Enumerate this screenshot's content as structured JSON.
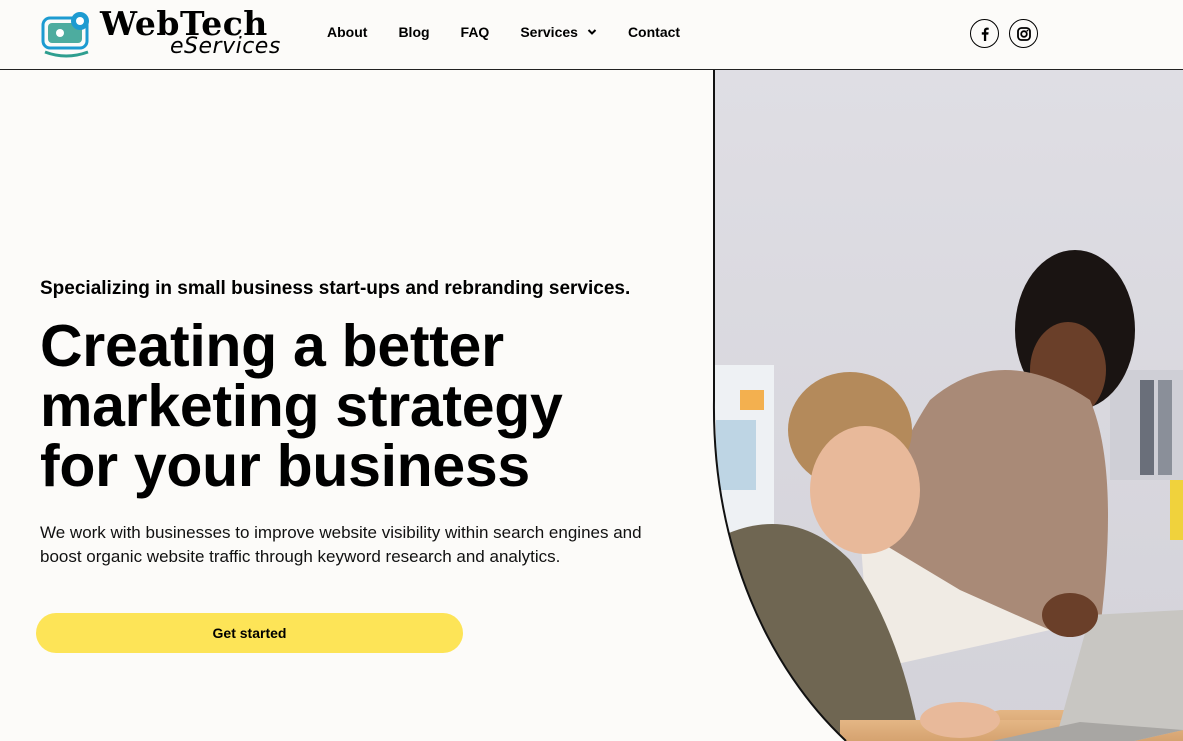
{
  "brand": {
    "name_line1": "WebTech",
    "name_line2": "eServices",
    "accent_blue": "#1d9bd1",
    "accent_teal": "#2e9e8f"
  },
  "nav": {
    "items": [
      {
        "label": "About"
      },
      {
        "label": "Blog"
      },
      {
        "label": "FAQ"
      },
      {
        "label": "Services",
        "has_dropdown": true
      },
      {
        "label": "Contact"
      }
    ]
  },
  "social": {
    "facebook": "facebook-icon",
    "instagram": "instagram-icon"
  },
  "hero": {
    "tagline": "Specializing in small business start-ups and rebranding services.",
    "headline_line1": "Creating a better",
    "headline_line2": "marketing strategy",
    "headline_line3": "for your business",
    "description": "We work with businesses to improve website visibility within search engines and boost organic website traffic through keyword research and analytics.",
    "cta_label": "Get started",
    "cta_color": "#fde457"
  }
}
